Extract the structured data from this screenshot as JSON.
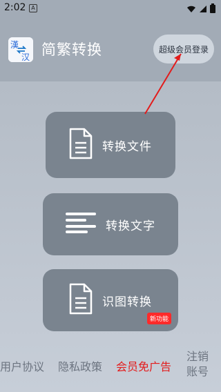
{
  "status_bar": {
    "time": "2:02",
    "a_icon": "A",
    "icons": [
      "wifi-icon",
      "signal-icon",
      "battery-icon"
    ]
  },
  "header": {
    "logo_text_top": "漢",
    "logo_text_bottom": "汉",
    "title": "简繁转换",
    "vip_login_label": "超级会员登录"
  },
  "actions": [
    {
      "label": "转换文件",
      "icon": "document-icon"
    },
    {
      "label": "转换文字",
      "icon": "text-lines-icon"
    },
    {
      "label": "识图转换",
      "icon": "document-icon",
      "badge": "新功能"
    }
  ],
  "footer": {
    "user_agreement": "用户协议",
    "privacy_policy": "隐私政策",
    "vip_no_ads": "会员免广告",
    "cancel_account": "注销账号"
  },
  "colors": {
    "top_bg": "#a2abb6",
    "button_bg": "#7a848f",
    "badge_red": "#ff2a2a",
    "arrow_red": "#e31b1b"
  }
}
